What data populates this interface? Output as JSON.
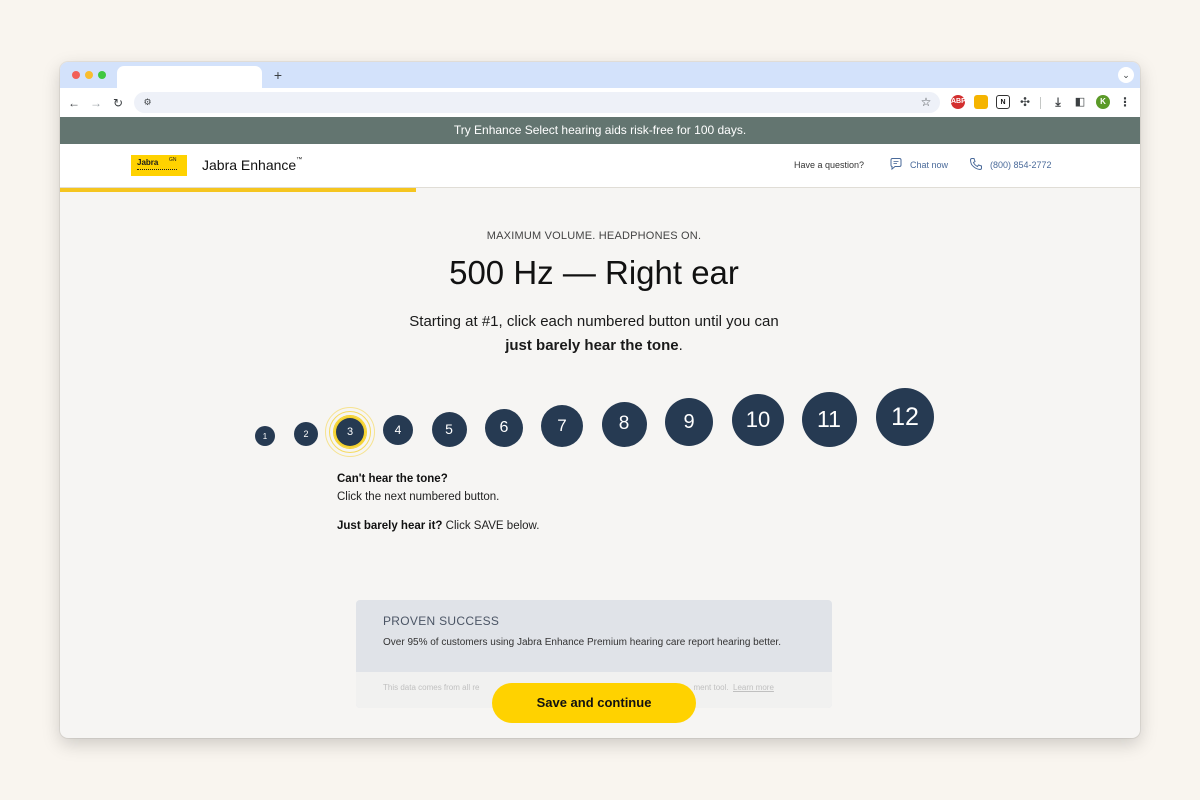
{
  "browser": {
    "new_tab_label": "+",
    "avatar_initial": "K",
    "extension_abp_label": "ABP"
  },
  "promo_banner": "Try Enhance Select hearing aids risk-free for 100 days.",
  "header": {
    "logo_text": "Jabra",
    "logo_superscript": "GN",
    "brand_name": "Jabra Enhance",
    "brand_tm": "™",
    "question": "Have a question?",
    "chat_label": "Chat now",
    "phone_label": "(800) 854-2772"
  },
  "progress": {
    "fraction": 0.33
  },
  "test": {
    "eyebrow": "MAXIMUM VOLUME. HEADPHONES ON.",
    "headline": "500 Hz — Right ear",
    "instruction_line1": "Starting at #1, click each numbered button until you can",
    "instruction_line2_bold": "just barely hear the tone",
    "instruction_line2_end": ".",
    "buttons": [
      "1",
      "2",
      "3",
      "4",
      "5",
      "6",
      "7",
      "8",
      "9",
      "10",
      "11",
      "12"
    ],
    "active_button": "3",
    "hint_title": "Can't hear the tone?",
    "hint_text": "Click the next numbered button.",
    "hint2_bold": "Just barely hear it?",
    "hint2_text": " Click SAVE below."
  },
  "card": {
    "title": "PROVEN SUCCESS",
    "body": "Over 95% of customers using Jabra Enhance Premium hearing care report hearing better.",
    "footnote": "This data comes from all re",
    "footnote_tail": "ment tool.",
    "learn_more": "Learn more"
  },
  "save_button": "Save and continue",
  "colors": {
    "accent_yellow": "#ffd200",
    "button_navy": "#263a52",
    "promo_green": "#637570"
  }
}
